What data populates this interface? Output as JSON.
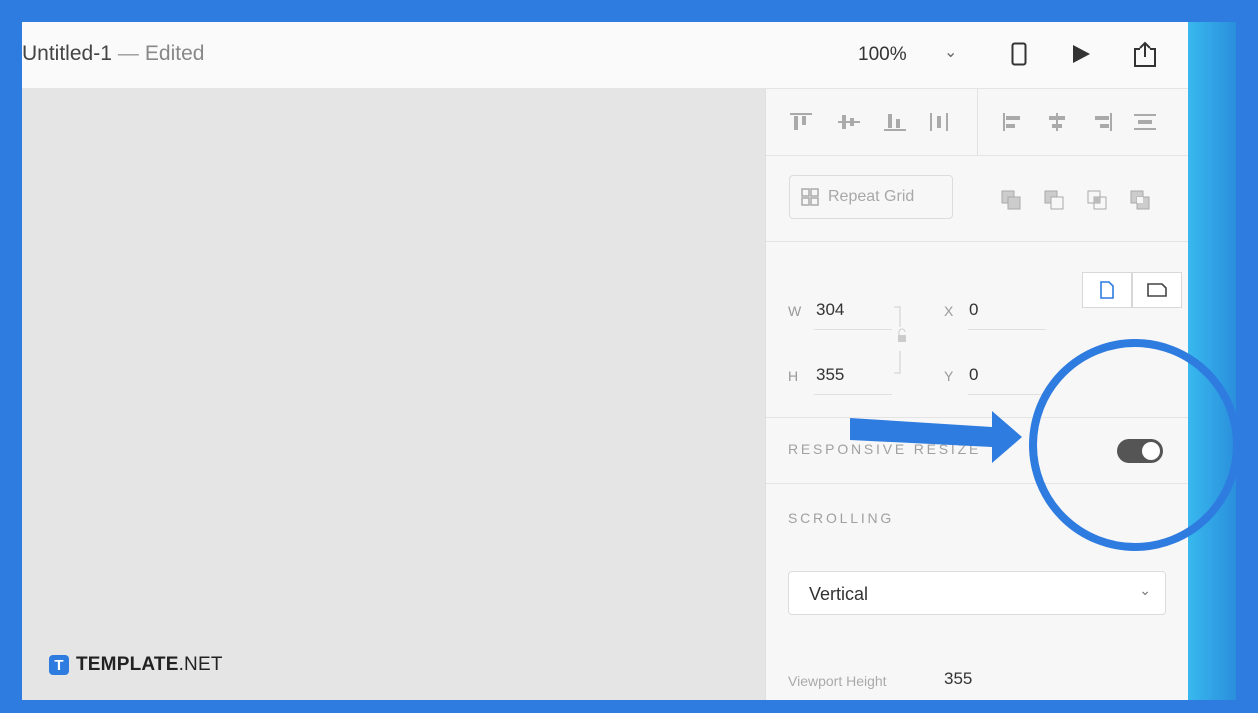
{
  "window": {
    "doc_name": "Untitled-1",
    "separator": "—",
    "status": "Edited",
    "zoom": "100%"
  },
  "toolbar_icons": [
    "device-preview-icon",
    "play-icon",
    "share-icon"
  ],
  "repeat_grid": {
    "label": "Repeat Grid"
  },
  "dimensions": {
    "w_label": "W",
    "w_value": "304",
    "h_label": "H",
    "h_value": "355",
    "x_label": "X",
    "x_value": "0",
    "y_label": "Y",
    "y_value": "0"
  },
  "responsive_resize": {
    "label": "RESPONSIVE RESIZE",
    "enabled": true
  },
  "scrolling": {
    "heading": "SCROLLING",
    "selected": "Vertical",
    "viewport_label": "Viewport Height",
    "viewport_value": "355"
  },
  "watermark": {
    "brand": "TEMPLATE",
    "suffix": ".NET"
  },
  "colors": {
    "accent_blue": "#2f7ce0",
    "toggle_on": "#555555"
  }
}
